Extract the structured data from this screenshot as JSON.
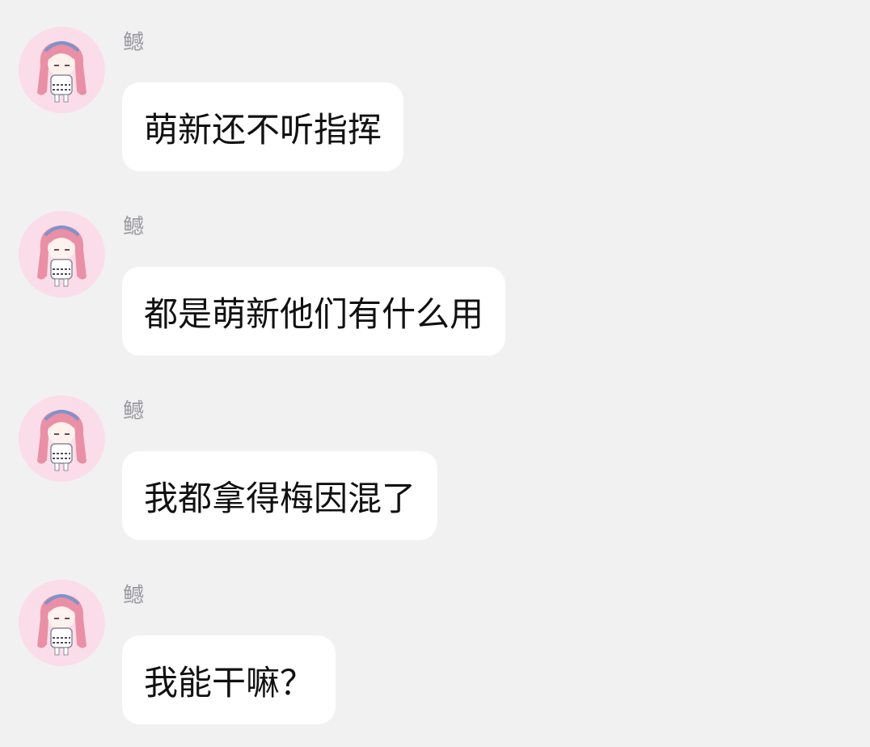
{
  "colors": {
    "background": "#f1f1f1",
    "bubble": "#ffffff",
    "text": "#111111",
    "sender": "#9a9aa2",
    "avatar_bg": "#fbdde9"
  },
  "messages": [
    {
      "sender": "鳡",
      "avatar_icon": "anime-girl-avatar-icon",
      "text": "萌新还不听指挥"
    },
    {
      "sender": "鳡",
      "avatar_icon": "anime-girl-avatar-icon",
      "text": "都是萌新他们有什么用"
    },
    {
      "sender": "鳡",
      "avatar_icon": "anime-girl-avatar-icon",
      "text": "我都拿得梅因混了"
    },
    {
      "sender": "鳡",
      "avatar_icon": "anime-girl-avatar-icon",
      "text": "我能干嘛？"
    }
  ]
}
